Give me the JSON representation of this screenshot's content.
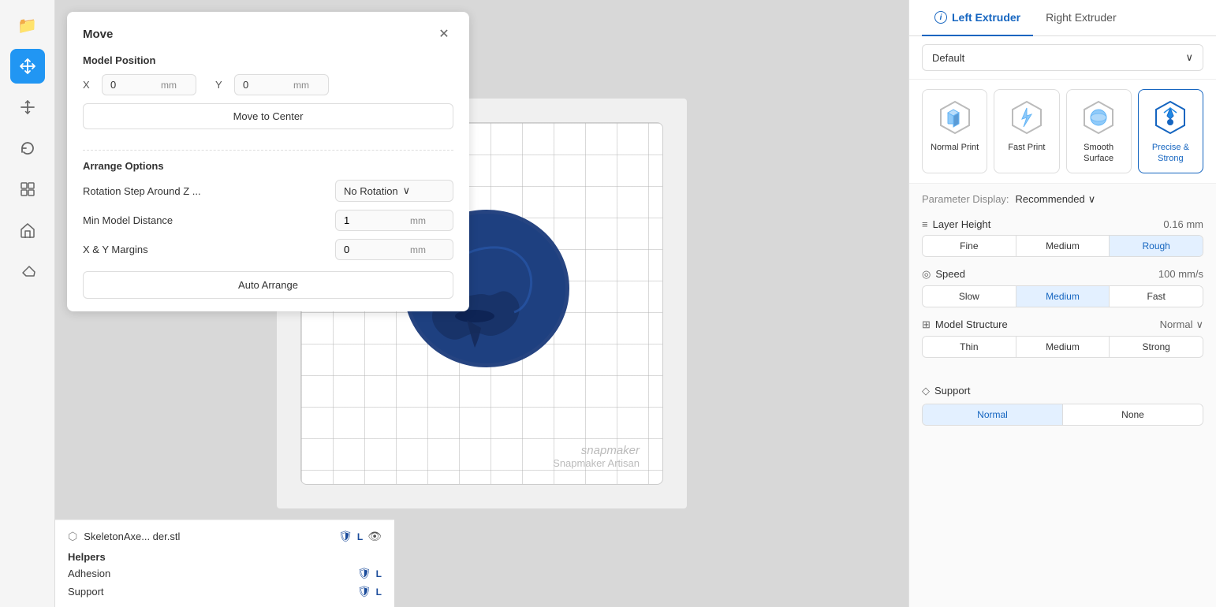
{
  "sidebar": {
    "icons": [
      {
        "name": "folder-icon",
        "symbol": "📁",
        "active": false
      },
      {
        "name": "move-icon",
        "symbol": "✛",
        "active": true
      },
      {
        "name": "scale-icon",
        "symbol": "↑",
        "active": false
      },
      {
        "name": "rotate-icon",
        "symbol": "↺",
        "active": false
      },
      {
        "name": "layers-icon",
        "symbol": "⊞",
        "active": false
      },
      {
        "name": "house-icon",
        "symbol": "⌂",
        "active": false
      },
      {
        "name": "eraser-icon",
        "symbol": "◇",
        "active": false
      }
    ]
  },
  "move_panel": {
    "title": "Move",
    "model_position_label": "Model Position",
    "x_label": "X",
    "y_label": "Y",
    "x_value": "0",
    "y_value": "0",
    "unit": "mm",
    "move_to_center_label": "Move to Center",
    "arrange_options_label": "Arrange Options",
    "rotation_label": "Rotation Step Around Z ...",
    "rotation_value": "No Rotation",
    "min_distance_label": "Min Model Distance",
    "min_distance_value": "1",
    "xy_margins_label": "X & Y Margins",
    "xy_margins_value": "0",
    "auto_arrange_label": "Auto Arrange"
  },
  "file_panel": {
    "file_icon": "⬡",
    "file_name": "SkeletonAxe...  der.stl",
    "shield": "🛡",
    "extruder_label": "L",
    "helpers_title": "Helpers",
    "adhesion_label": "Adhesion",
    "support_label": "Support",
    "adhesion_extruder": "L",
    "support_extruder": "L"
  },
  "right_panel": {
    "left_extruder_tab": "Left Extruder",
    "right_extruder_tab": "Right Extruder",
    "profile_label": "Default",
    "print_modes": [
      {
        "id": "normal-print",
        "label": "Normal Print",
        "active": false
      },
      {
        "id": "fast-print",
        "label": "Fast Print",
        "active": false
      },
      {
        "id": "smooth-surface",
        "label": "Smooth Surface",
        "active": false
      },
      {
        "id": "precise-strong",
        "label": "Precise & Strong",
        "active": true
      }
    ],
    "parameter_display_label": "Parameter Display:",
    "parameter_display_value": "Recommended",
    "params": [
      {
        "id": "layer-height",
        "icon": "≡",
        "name": "Layer Height",
        "value": "0.16 mm",
        "buttons": [
          {
            "label": "Fine",
            "active": false
          },
          {
            "label": "Medium",
            "active": false
          },
          {
            "label": "Rough",
            "active": true
          }
        ]
      },
      {
        "id": "speed",
        "icon": "◎",
        "name": "Speed",
        "value": "100 mm/s",
        "buttons": [
          {
            "label": "Slow",
            "active": false
          },
          {
            "label": "Medium",
            "active": true
          },
          {
            "label": "Fast",
            "active": false
          }
        ]
      },
      {
        "id": "model-structure",
        "icon": "⊞",
        "name": "Model Structure",
        "value": "Normal",
        "buttons": [
          {
            "label": "Thin",
            "active": false
          },
          {
            "label": "Medium",
            "active": false
          },
          {
            "label": "Strong",
            "active": false
          }
        ]
      }
    ],
    "support": {
      "name": "Support",
      "buttons": [
        {
          "label": "Normal",
          "active": true
        },
        {
          "label": "None",
          "active": false
        }
      ]
    }
  },
  "canvas": {
    "watermark_brand": "snapmaker",
    "watermark_model": "Snapmaker Artisan"
  }
}
